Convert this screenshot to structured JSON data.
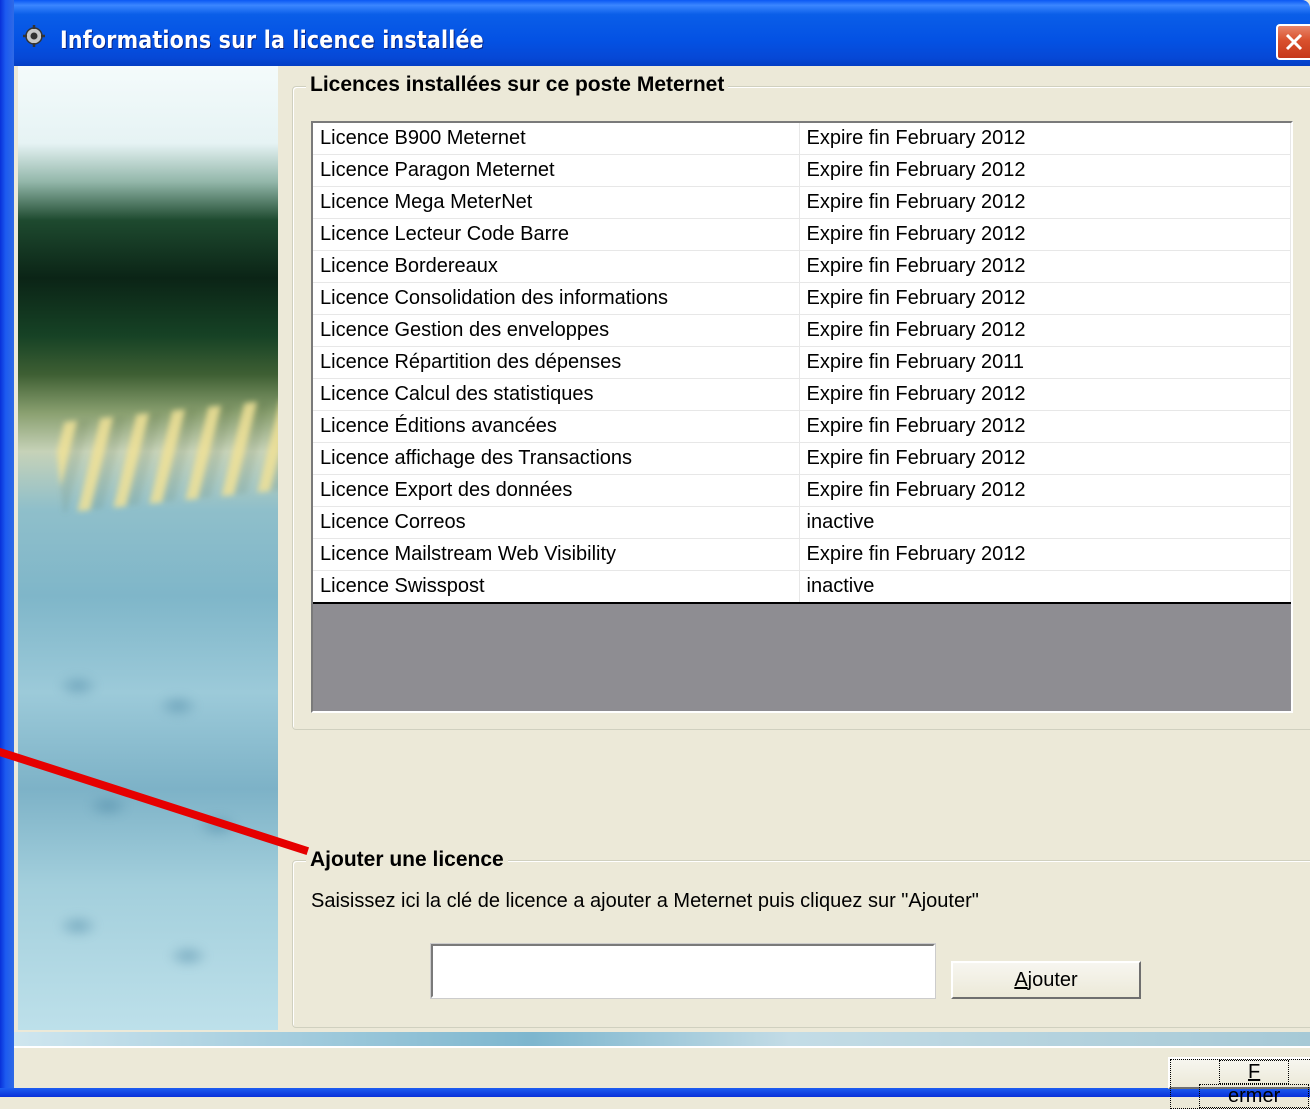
{
  "window": {
    "title": "Informations sur la licence installée",
    "title_bar_color": "#0552e4",
    "close_button_color": "#d9512d"
  },
  "installed": {
    "legend": "Licences installées sur ce poste Meternet",
    "rows": [
      {
        "name": "Licence B900 Meternet",
        "status": "Expire fin February 2012"
      },
      {
        "name": "Licence Paragon Meternet",
        "status": "Expire fin February 2012"
      },
      {
        "name": "Licence Mega MeterNet",
        "status": "Expire fin February 2012"
      },
      {
        "name": "Licence Lecteur Code Barre",
        "status": "Expire fin February 2012"
      },
      {
        "name": "Licence Bordereaux",
        "status": "Expire fin February 2012"
      },
      {
        "name": "Licence Consolidation des informations",
        "status": "Expire fin February 2012"
      },
      {
        "name": "Licence Gestion des enveloppes",
        "status": "Expire fin February 2012"
      },
      {
        "name": "Licence Répartition des dépenses",
        "status": "Expire fin February 2011"
      },
      {
        "name": "Licence Calcul des statistiques",
        "status": "Expire fin February 2012"
      },
      {
        "name": "Licence Éditions avancées",
        "status": "Expire fin February 2012"
      },
      {
        "name": "Licence affichage des Transactions",
        "status": "Expire fin February 2012"
      },
      {
        "name": "Licence Export des données",
        "status": "Expire fin February 2012"
      },
      {
        "name": "Licence Correos",
        "status": "inactive"
      },
      {
        "name": "Licence Mailstream Web Visibility",
        "status": "Expire fin February 2012"
      },
      {
        "name": "Licence Swisspost",
        "status": "inactive"
      }
    ]
  },
  "add_license": {
    "legend": "Ajouter une licence",
    "hint": "Saisissez ici la clé de licence a ajouter a Meternet puis cliquez sur \"Ajouter\"",
    "input_value": "",
    "add_button_first_letter": "A",
    "add_button_rest": "jouter"
  },
  "footer": {
    "close_button_first_letter": "F",
    "close_button_rest": "ermer"
  },
  "annotation": {
    "color": "#e60000"
  }
}
